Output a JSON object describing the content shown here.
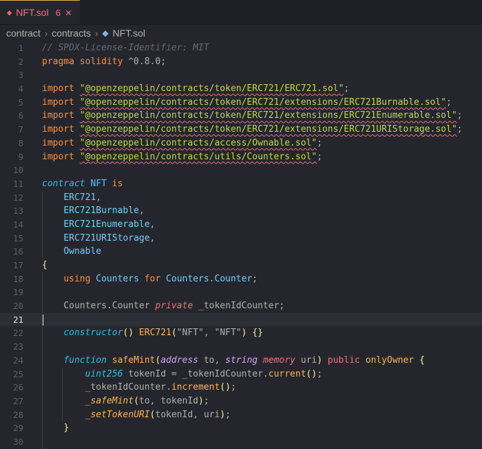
{
  "tab": {
    "filename": "NFT.sol",
    "problem_count": "6",
    "close_glyph": "✕",
    "file_icon": "solidity-icon"
  },
  "breadcrumb": {
    "items": [
      "contract",
      "contracts",
      "NFT.sol"
    ],
    "separator": "›"
  },
  "editor": {
    "cursor_line": 21,
    "line_numbers": [
      "1",
      "2",
      "3",
      "4",
      "5",
      "6",
      "7",
      "8",
      "9",
      "10",
      "11",
      "12",
      "13",
      "14",
      "15",
      "16",
      "17",
      "18",
      "19",
      "20",
      "21",
      "22",
      "23",
      "24",
      "25",
      "26",
      "27",
      "28",
      "29",
      "30"
    ],
    "lines": [
      [
        [
          "cm",
          "// SPDX-License-Identifier: MIT"
        ]
      ],
      [
        [
          "kw",
          "pragma solidity "
        ],
        [
          "pl",
          "^0.8.0;"
        ]
      ],
      [],
      [
        [
          "kw",
          "import "
        ],
        [
          "str sq",
          "\"@openzeppelin/contracts/token/ERC721/ERC721.sol\""
        ],
        [
          "pl",
          ";"
        ]
      ],
      [
        [
          "kw",
          "import "
        ],
        [
          "str sq",
          "\"@openzeppelin/contracts/token/ERC721/extensions/ERC721Burnable.sol\""
        ],
        [
          "pl",
          ";"
        ]
      ],
      [
        [
          "kw",
          "import "
        ],
        [
          "str sq",
          "\"@openzeppelin/contracts/token/ERC721/extensions/ERC721Enumerable.sol\""
        ],
        [
          "pl",
          ";"
        ]
      ],
      [
        [
          "kw",
          "import "
        ],
        [
          "str sq",
          "\"@openzeppelin/contracts/token/ERC721/extensions/ERC721URIStorage.sol\""
        ],
        [
          "pl",
          ";"
        ]
      ],
      [
        [
          "kw",
          "import "
        ],
        [
          "str sq",
          "\"@openzeppelin/contracts/access/Ownable.sol\""
        ],
        [
          "pl",
          ";"
        ]
      ],
      [
        [
          "kw",
          "import "
        ],
        [
          "str sq",
          "\"@openzeppelin/contracts/utils/Counters.sol\""
        ],
        [
          "pl",
          ";"
        ]
      ],
      [],
      [
        [
          "tyi",
          "contract "
        ],
        [
          "ty",
          "NFT "
        ],
        [
          "kw",
          "is"
        ]
      ],
      [
        [
          "pl",
          "    "
        ],
        [
          "ty2",
          "ERC721"
        ],
        [
          "pl",
          ","
        ]
      ],
      [
        [
          "pl",
          "    "
        ],
        [
          "ty2",
          "ERC721Burnable"
        ],
        [
          "pl",
          ","
        ]
      ],
      [
        [
          "pl",
          "    "
        ],
        [
          "ty2",
          "ERC721Enumerable"
        ],
        [
          "pl",
          ","
        ]
      ],
      [
        [
          "pl",
          "    "
        ],
        [
          "ty2",
          "ERC721URIStorage"
        ],
        [
          "pl",
          ","
        ]
      ],
      [
        [
          "pl",
          "    "
        ],
        [
          "ty2",
          "Ownable"
        ]
      ],
      [
        [
          "par",
          "{"
        ]
      ],
      [
        [
          "pl",
          "    "
        ],
        [
          "kw",
          "using "
        ],
        [
          "ty2",
          "Counters "
        ],
        [
          "kw",
          "for "
        ],
        [
          "ty2",
          "Counters"
        ],
        [
          "pl",
          "."
        ],
        [
          "ty2",
          "Counter"
        ],
        [
          "pl",
          ";"
        ]
      ],
      [],
      [
        [
          "pl",
          "    Counters.Counter "
        ],
        [
          "pri",
          "private "
        ],
        [
          "pl",
          "_tokenIdCounter;"
        ]
      ],
      [],
      [
        [
          "pl",
          "    "
        ],
        [
          "tyi",
          "constructor"
        ],
        [
          "par",
          "() "
        ],
        [
          "fn",
          "ERC721"
        ],
        [
          "par",
          "("
        ],
        [
          "pl",
          "\"NFT\", \"NFT\""
        ],
        [
          "par",
          ") {}"
        ]
      ],
      [],
      [
        [
          "pl",
          "    "
        ],
        [
          "tyi",
          "function "
        ],
        [
          "fn",
          "safeMint"
        ],
        [
          "par",
          "("
        ],
        [
          "param",
          "address "
        ],
        [
          "pl",
          "to, "
        ],
        [
          "param",
          "string "
        ],
        [
          "pri",
          "memory "
        ],
        [
          "pl",
          "uri"
        ],
        [
          "par",
          ") "
        ],
        [
          "mem",
          "public "
        ],
        [
          "fn",
          "onlyOwner "
        ],
        [
          "par",
          "{"
        ]
      ],
      [
        [
          "pl",
          "        "
        ],
        [
          "tyi",
          "uint256 "
        ],
        [
          "pl",
          "tokenId = _tokenIdCounter."
        ],
        [
          "fn",
          "current"
        ],
        [
          "par",
          "()"
        ],
        [
          "pl",
          ";"
        ]
      ],
      [
        [
          "pl",
          "        _tokenIdCounter."
        ],
        [
          "fn",
          "increment"
        ],
        [
          "par",
          "()"
        ],
        [
          "pl",
          ";"
        ]
      ],
      [
        [
          "pl",
          "        "
        ],
        [
          "fni",
          "_safeMint"
        ],
        [
          "par",
          "("
        ],
        [
          "pl",
          "to, tokenId"
        ],
        [
          "par",
          ")"
        ],
        [
          "pl",
          ";"
        ]
      ],
      [
        [
          "pl",
          "        "
        ],
        [
          "fni",
          "_setTokenURI"
        ],
        [
          "par",
          "("
        ],
        [
          "pl",
          "tokenId, uri"
        ],
        [
          "par",
          ")"
        ],
        [
          "pl",
          ";"
        ]
      ],
      [
        [
          "pl",
          "    "
        ],
        [
          "par",
          "}"
        ]
      ],
      []
    ]
  }
}
